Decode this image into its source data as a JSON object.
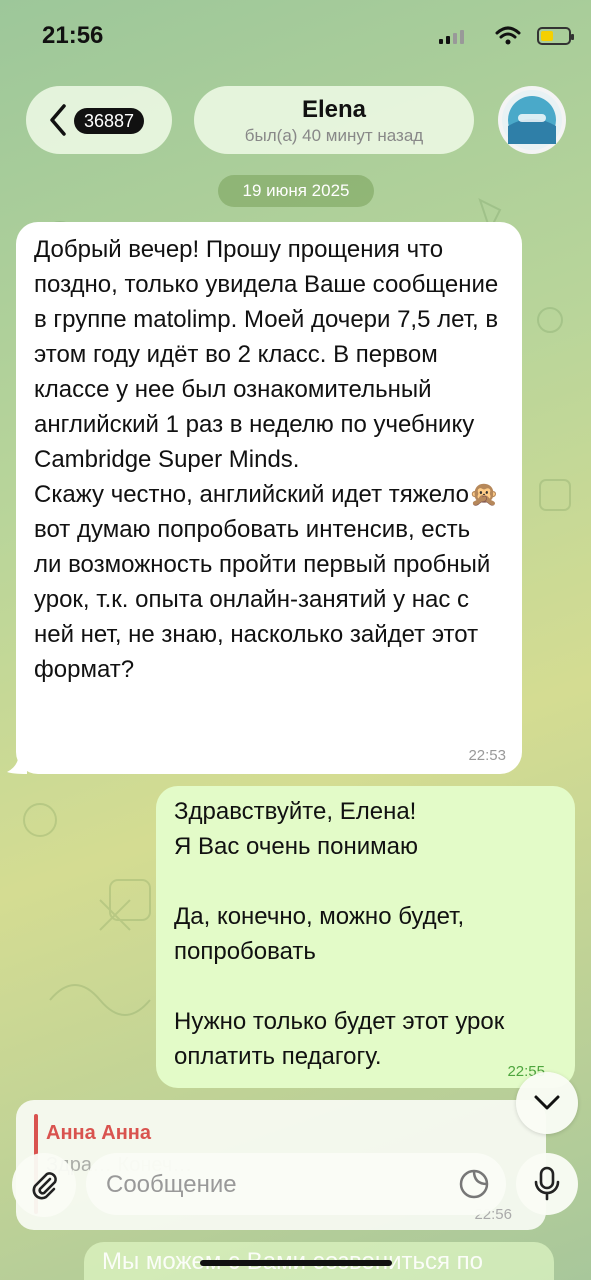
{
  "status_bar": {
    "time": "21:56"
  },
  "header": {
    "back_count": "36887",
    "contact_name": "Elena",
    "last_seen": "был(а) 40 минут назад"
  },
  "date_separator": "19 июня 2025",
  "messages": [
    {
      "direction": "incoming",
      "text": "Добрый вечер! Прошу прощения что поздно, только увидела Ваше сообщение в группе matolimp. Моей дочери 7,5 лет, в этом году идёт во 2 класс. В первом классе у нее был ознакомительный английский 1 раз в неделю по учебнику Cambridge Super Minds.\nСкажу честно, английский идет тяжело🙊 вот думаю попробовать интенсив, есть ли возможность пройти первый пробный урок, т.к. опыта онлайн-занятий у нас с ней нет, не знаю, насколько зайдет этот формат?",
      "time": "22:53"
    },
    {
      "direction": "outgoing",
      "text": "Здравствуйте, Елена!\nЯ Вас очень понимаю\n\nДа, конечно, можно будет, попробовать\n\nНужно только будет этот урок оплатить педагогу.",
      "time": "22:55"
    }
  ],
  "reply_preview": {
    "sender": "Анна Анна",
    "text": "Здра… Конеч…",
    "time": "22:56"
  },
  "composer": {
    "placeholder": "Сообщение"
  },
  "bottom_partial_message": "Мы можем с Вами созвониться по",
  "colors": {
    "incoming_bubble": "#ffffff",
    "outgoing_bubble": "#e3fbc8",
    "reply_accent": "#d9534f",
    "outgoing_time": "#4ea53e"
  },
  "icons": {
    "back": "chevron-left-icon",
    "scroll": "chevron-down-icon",
    "attach": "paperclip-icon",
    "sticker": "sticker-icon",
    "mic": "microphone-icon"
  }
}
